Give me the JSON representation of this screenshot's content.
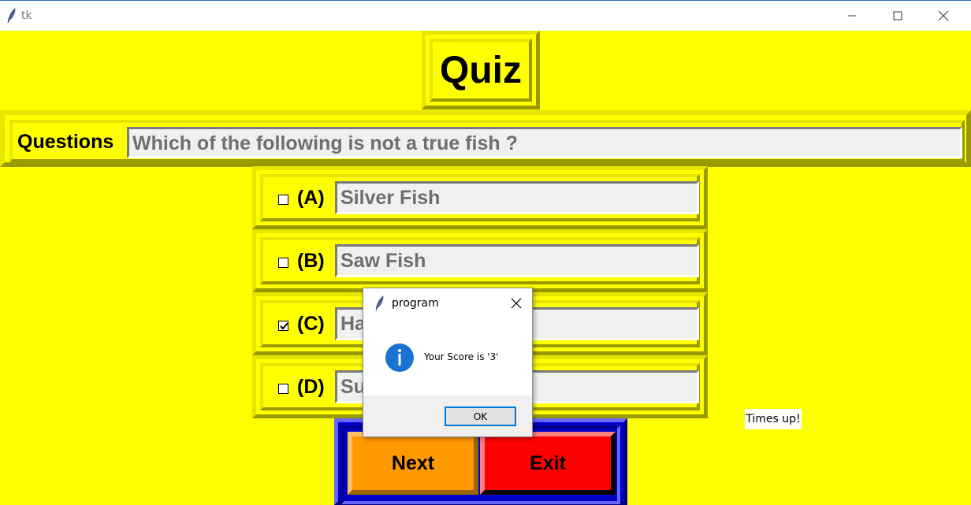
{
  "window": {
    "title": "tk",
    "icon": "feather-icon",
    "controls": [
      "minimize-icon",
      "maximize-icon",
      "close-icon"
    ]
  },
  "quiz": {
    "title": "Quiz",
    "question_label": "Questions",
    "question_text": "Which of the following is not a true fish ?",
    "options": [
      {
        "letter": "(A)",
        "text": "Silver Fish",
        "checked": false
      },
      {
        "letter": "(B)",
        "text": "Saw Fish",
        "checked": false
      },
      {
        "letter": "(C)",
        "text": "Ha",
        "checked": true
      },
      {
        "letter": "(D)",
        "text": "Su",
        "checked": false
      }
    ],
    "next_label": "Next",
    "exit_label": "Exit",
    "timer_text": "Times up!"
  },
  "dialog": {
    "title": "program",
    "message": "Your Score is '3'",
    "ok_label": "OK",
    "icon": "info-icon"
  },
  "colors": {
    "background": "#ffff00",
    "next_button": "#ff9900",
    "exit_button": "#ff0000",
    "button_frame": "#0000cc",
    "accent": "#0078d7"
  }
}
